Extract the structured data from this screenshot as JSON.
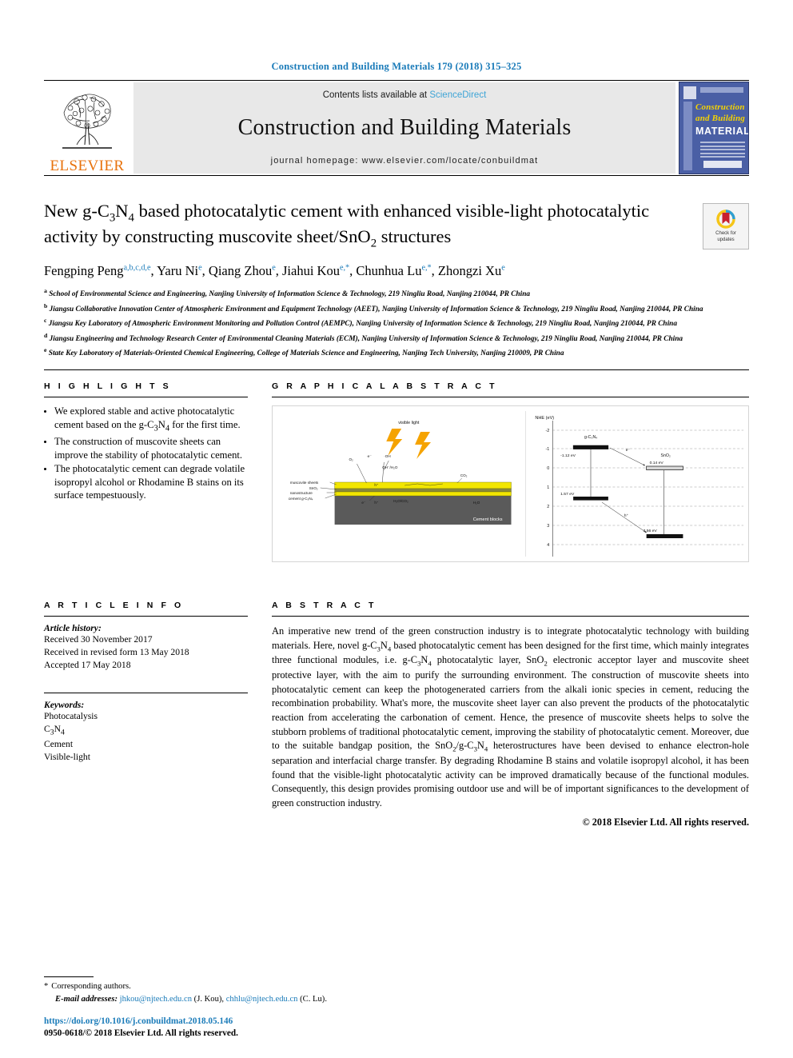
{
  "running_head": "Construction and Building Materials 179 (2018) 315–325",
  "masthead": {
    "publisher": "ELSEVIER",
    "contents_prefix": "Contents lists available at ",
    "contents_link": "ScienceDirect",
    "journal_name": "Construction and Building Materials",
    "homepage": "journal homepage: www.elsevier.com/locate/conbuildmat",
    "cover": {
      "line1": "Construction",
      "line2": "and Building",
      "line3": "MATERIALS"
    }
  },
  "article": {
    "title_line1": "New g-C3N4 based photocatalytic cement with enhanced visible-light",
    "title_line2": "photocatalytic activity by constructing muscovite sheet/SnO2 structures",
    "crossmark_label_1": "Check for",
    "crossmark_label_2": "updates",
    "authors": [
      {
        "name": "Fengping Peng",
        "sup": "a,b,c,d,e"
      },
      {
        "name": "Yaru Ni",
        "sup": "e"
      },
      {
        "name": "Qiang Zhou",
        "sup": "e"
      },
      {
        "name": "Jiahui Kou",
        "sup": "e,*"
      },
      {
        "name": "Chunhua Lu",
        "sup": "e,*"
      },
      {
        "name": "Zhongzi Xu",
        "sup": "e"
      }
    ],
    "affiliations": [
      {
        "mark": "a",
        "text": "School of Environmental Science and Engineering, Nanjing University of Information Science & Technology, 219 Ningliu Road, Nanjing 210044, PR China"
      },
      {
        "mark": "b",
        "text": "Jiangsu Collaborative Innovation Center of Atmospheric Environment and Equipment Technology (AEET), Nanjing University of Information Science & Technology, 219 Ningliu Road, Nanjing 210044, PR China"
      },
      {
        "mark": "c",
        "text": "Jiangsu Key Laboratory of Atmospheric Environment Monitoring and Pollution Control (AEMPC), Nanjing University of Information Science & Technology, 219 Ningliu Road, Nanjing 210044, PR China"
      },
      {
        "mark": "d",
        "text": "Jiangsu Engineering and Technology Research Center of Environmental Cleaning Materials (ECM), Nanjing University of Information Science & Technology, 219 Ningliu Road, Nanjing 210044, PR China"
      },
      {
        "mark": "e",
        "text": "State Key Laboratory of Materials-Oriented Chemical Engineering, College of Materials Science and Engineering, Nanjing Tech University, Nanjing 210009, PR China"
      }
    ]
  },
  "highlights": {
    "heading": "H I G H L I G H T S",
    "items": [
      "We explored stable and active photocatalytic cement based on the g-C3N4 for the first time.",
      "The construction of muscovite sheets can improve the stability of photocatalytic cement.",
      "The photocatalytic cement can degrade volatile isopropyl alcohol or Rhodamine B stains on its surface tempestuously."
    ]
  },
  "graphical_abstract": {
    "heading": "G R A P H I C A L   A B S T R A C T",
    "figure": {
      "light_label": "visible light",
      "layers": [
        "muscovite sheets",
        "SnO2",
        "nanostructure",
        "cement g-C3N4"
      ],
      "substrate_label": "Cement blocks",
      "band_axis_label": "NHE (eV)",
      "band_ticks": [
        "-2",
        "-1",
        "0",
        "1",
        "2",
        "3",
        "4"
      ],
      "species_left": "g-C3N4",
      "species_right": "SnO2",
      "levels": [
        {
          "label": "-1.12 eV",
          "species": "g-C3N4",
          "type": "CB"
        },
        {
          "label": "1.57 eV",
          "species": "g-C3N4",
          "type": "VB"
        },
        {
          "label": "0.14 eV",
          "species": "SnO2",
          "type": "CB"
        },
        {
          "label": "3.56 eV",
          "species": "SnO2",
          "type": "VB"
        }
      ],
      "carriers": [
        "e-",
        "h+"
      ],
      "products": [
        "O2",
        "·OH",
        "OH-/H2O",
        "CO2",
        "H2O"
      ]
    }
  },
  "article_info": {
    "heading": "A R T I C L E   I N F O",
    "history_label": "Article history:",
    "history": [
      "Received 30 November 2017",
      "Received in revised form 13 May 2018",
      "Accepted 17 May 2018"
    ],
    "keywords_label": "Keywords:",
    "keywords": [
      "Photocatalysis",
      "C3N4",
      "Cement",
      "Visible-light"
    ]
  },
  "abstract": {
    "heading": "A B S T R A C T",
    "paragraphs": [
      "An imperative new trend of the green construction industry is to integrate photocatalytic technology with building materials. Here, novel g-C3N4 based photocatalytic cement has been designed for the first time, which mainly integrates three functional modules, i.e. g-C3N4 photocatalytic layer, SnO2 electronic acceptor layer and muscovite sheet protective layer, with the aim to purify the surrounding environment. The construction of muscovite sheets into photocatalytic cement can keep the photogenerated carriers from the alkali ionic species in cement, reducing the recombination probability. What's more, the muscovite sheet layer can also prevent the products of the photocatalytic reaction from accelerating the carbonation of cement. Hence, the presence of muscovite sheets helps to solve the stubborn problems of traditional photocatalytic cement, improving the stability of photocatalytic cement. Moreover, due to the suitable bandgap position, the SnO2/g-C3N4 heterostructures have been devised to enhance electron-hole separation and interfacial charge transfer. By degrading Rhodamine B stains and volatile isopropyl alcohol, it has been found that the visible-light photocatalytic activity can be improved dramatically because of the functional modules. Consequently, this design provides promising outdoor use and will be of important significances to the development of green construction industry."
    ],
    "copyright": "© 2018 Elsevier Ltd. All rights reserved."
  },
  "footnotes": {
    "corresponding_marker": "*",
    "corresponding_text": "Corresponding authors.",
    "email_label": "E-mail addresses:",
    "emails": [
      {
        "address": "jhkou@njtech.edu.cn",
        "person": "(J. Kou)"
      },
      {
        "address": "chhlu@njtech.edu.cn",
        "person": "(C. Lu)"
      }
    ]
  },
  "footer": {
    "doi": "https://doi.org/10.1016/j.conbuildmat.2018.05.146",
    "issn": "0950-0618/© 2018 Elsevier Ltd. All rights reserved."
  },
  "colors": {
    "link_blue": "#1a7bb9",
    "sciencedirect_blue": "#3da4d6",
    "elsevier_orange": "#e8720c",
    "cover_blue": "#4a5fa5",
    "highlight_yellow": "#f2e600"
  }
}
